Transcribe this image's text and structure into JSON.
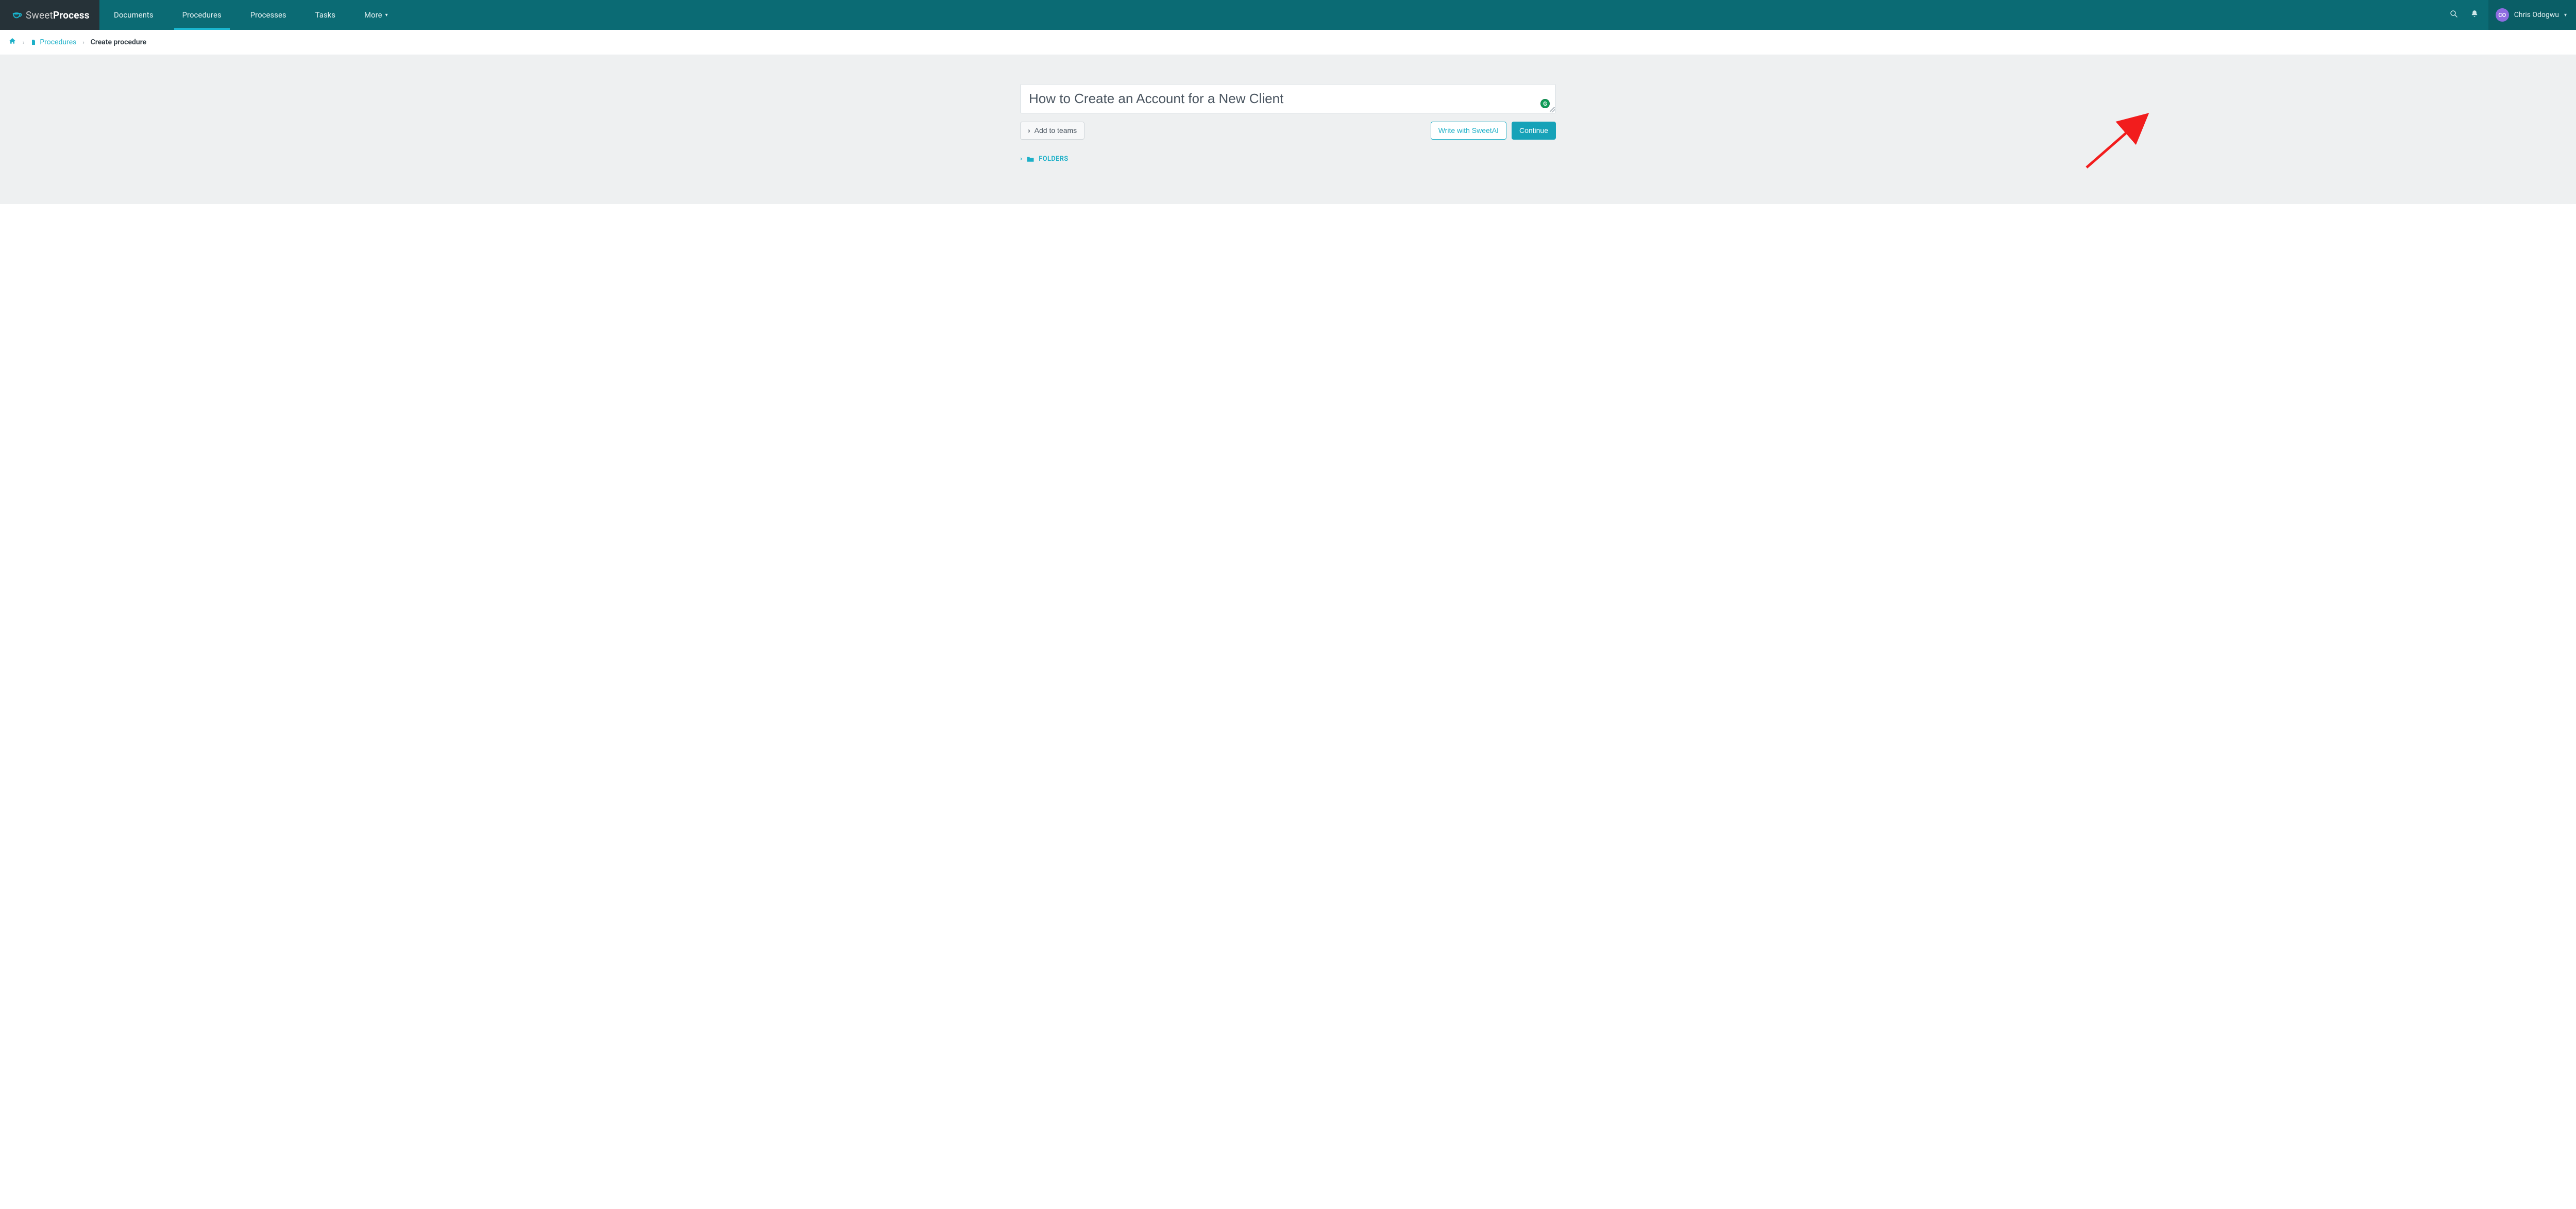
{
  "brand": {
    "light": "Sweet",
    "bold": "Process"
  },
  "nav": {
    "items": [
      {
        "label": "Documents",
        "active": false
      },
      {
        "label": "Procedures",
        "active": true
      },
      {
        "label": "Processes",
        "active": false
      },
      {
        "label": "Tasks",
        "active": false
      },
      {
        "label": "More",
        "active": false,
        "has_caret": true
      }
    ]
  },
  "user": {
    "initials": "CO",
    "name": "Chris Odogwu"
  },
  "breadcrumb": {
    "home_icon": "home-icon",
    "link_label": "Procedures",
    "current": "Create procedure"
  },
  "form": {
    "title_value": "How to Create an Account for a New Client",
    "add_to_teams_label": "Add to teams",
    "write_ai_label": "Write with SweetAI",
    "continue_label": "Continue",
    "folders_label": "FOLDERS"
  },
  "colors": {
    "header_bg": "#0b6b74",
    "logo_bg": "#263238",
    "accent": "#1db0c8",
    "button_teal": "#16a2b8",
    "grey_bg": "#eef0f1",
    "arrow": "#f21d1d"
  },
  "grammarly_badge": "G"
}
